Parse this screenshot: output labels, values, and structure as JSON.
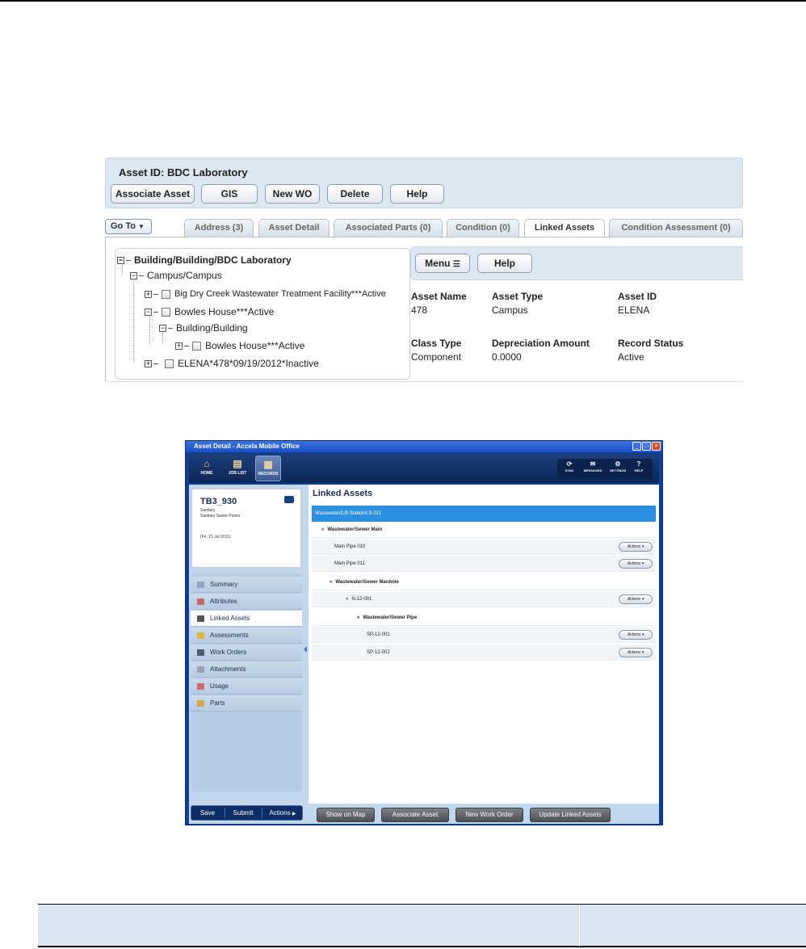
{
  "web": {
    "asset_title": "Asset ID: BDC Laboratory",
    "buttons": [
      "Associate Asset",
      "GIS",
      "New WO",
      "Delete",
      "Help"
    ],
    "goto_label": "Go To",
    "tabs": [
      "Address (3)",
      "Asset Detail",
      "Associated Parts (0)",
      "Condition (0)",
      "Linked Assets",
      "Condition Assessment (0)"
    ],
    "active_tab": "Linked Assets",
    "tree": [
      "Building/Building/BDC Laboratory",
      "Campus/Campus",
      "Big Dry Creek Wastewater Treatment Facility***Active",
      "Bowles House***Active",
      "Building/Building",
      "Bowles House***Active",
      "ELENA*478*09/19/2012*Inactive"
    ],
    "detail_buttons": {
      "menu": "Menu",
      "help": "Help"
    },
    "fields": {
      "asset_name_label": "Asset Name",
      "asset_name": "478",
      "asset_type_label": "Asset Type",
      "asset_type": "Campus",
      "asset_id_label": "Asset ID",
      "asset_id": "ELENA",
      "class_type_label": "Class Type",
      "class_type": "Component",
      "depreciation_label": "Depreciation Amount",
      "depreciation": "0.0000",
      "record_status_label": "Record Status",
      "record_status": "Active"
    }
  },
  "mobile": {
    "window_title": "Asset Detail - Accela Mobile Office",
    "nav": [
      "HOME",
      "JOB LIST",
      "RECORDS"
    ],
    "system": [
      "SYNC",
      "MESSAGES",
      "SETTINGS",
      "HELP"
    ],
    "card": {
      "id": "TB3_930",
      "line1": "Sanitary",
      "line2": "Sanitary Sewer Points",
      "date": "(Fri, 15 Jul 2011)"
    },
    "side_items": [
      "Summary",
      "Attributes",
      "Linked Assets",
      "Assessments",
      "Work Orders",
      "Attachments",
      "Usage",
      "Parts"
    ],
    "footer": [
      "Save",
      "Submit",
      "Actions"
    ],
    "panel_title": "Linked Assets",
    "rows": [
      {
        "text": "Wastewater/Lift Station/LS-011"
      },
      {
        "text": "Wastewater/Sewer Main"
      },
      {
        "text": "Main Pipe 010"
      },
      {
        "text": "Main Pipe 011"
      },
      {
        "text": "Wastewater/Sewer Manhole"
      },
      {
        "text": "N-12-001"
      },
      {
        "text": "Wastewater/Sewer Pipe"
      },
      {
        "text": "SP-12-001"
      },
      {
        "text": "SP-12-002"
      }
    ],
    "actions_label": "Actions",
    "bottom_buttons": [
      "Show on Map",
      "Associate Asset",
      "New Work Order",
      "Update Linked Assets"
    ]
  },
  "colors": {
    "header_bg": "#dde7f2",
    "selected": "#3b8ae6",
    "mobile_frame": "#0f3e93",
    "strip": "#dbe5f1"
  }
}
